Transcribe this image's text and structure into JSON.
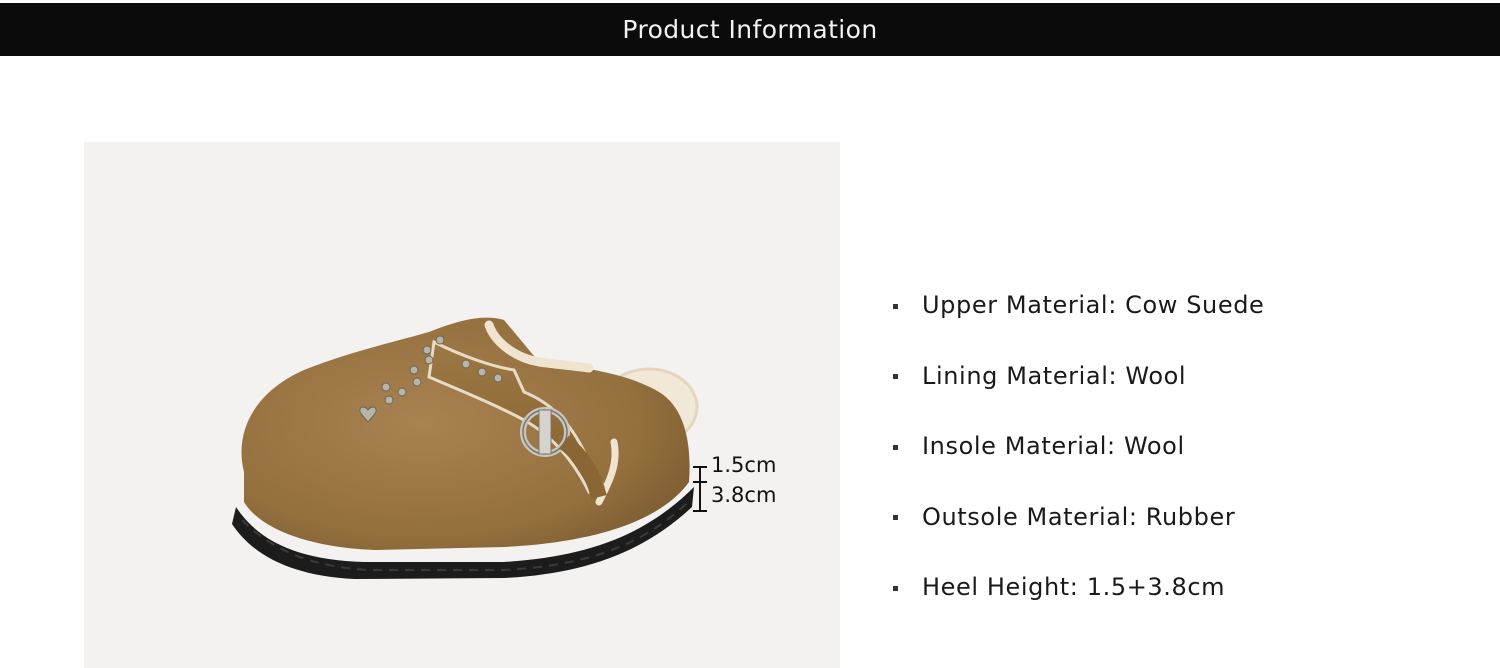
{
  "header": {
    "title": "Product Information"
  },
  "product_image": {
    "measurements": {
      "upper": "1.5cm",
      "lower": "3.8cm"
    },
    "colors": {
      "suede": "#9a7340",
      "fur": "#f1e8d8",
      "sole": "#1c1c1c",
      "background": "#f3f2f0"
    }
  },
  "specs": [
    {
      "label": "Upper Material: Cow Suede"
    },
    {
      "label": "Lining Material: Wool"
    },
    {
      "label": "Insole Material: Wool"
    },
    {
      "label": "Outsole Material: Rubber"
    },
    {
      "label": "Heel Height: 1.5+3.8cm"
    }
  ]
}
